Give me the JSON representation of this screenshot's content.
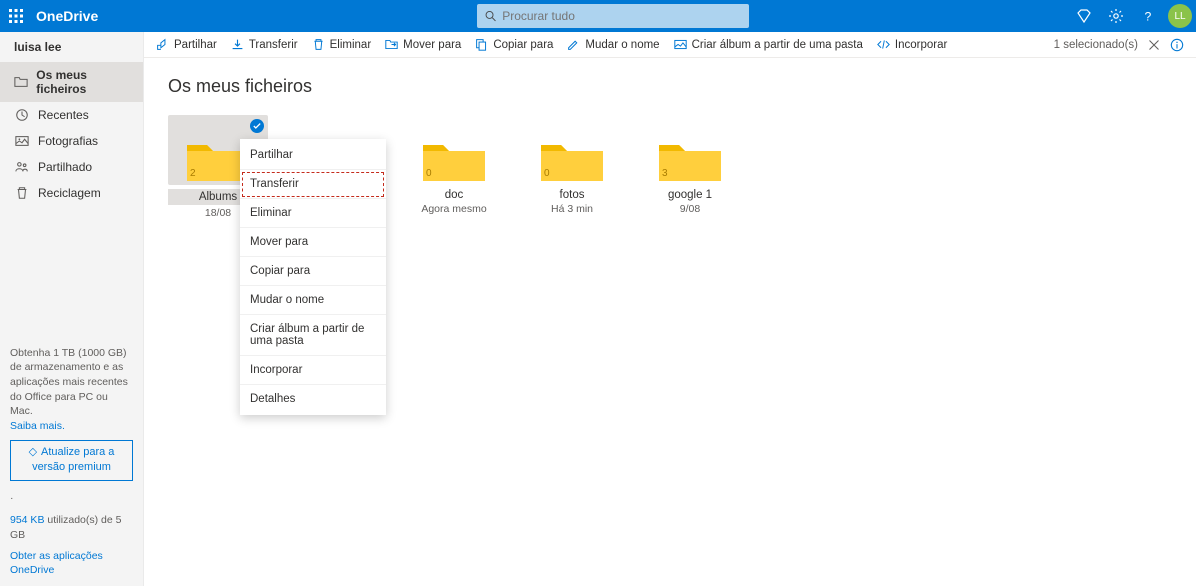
{
  "header": {
    "app_name": "OneDrive",
    "search_placeholder": "Procurar tudo",
    "avatar_initials": "LL"
  },
  "sidebar": {
    "user": "luisa lee",
    "items": [
      {
        "label": "Os meus ficheiros",
        "active": true
      },
      {
        "label": "Recentes"
      },
      {
        "label": "Fotografias"
      },
      {
        "label": "Partilhado"
      },
      {
        "label": "Reciclagem"
      }
    ],
    "promo": "Obtenha 1 TB (1000 GB) de armazenamento e as aplicações mais recentes do Office para PC ou Mac.",
    "learn_more": "Saiba mais.",
    "premium_btn": "Atualize para a versão premium",
    "storage_used": "954 KB",
    "storage_text": " utilizado(s) de 5 GB",
    "get_apps": "Obter as aplicações OneDrive"
  },
  "cmdbar": {
    "items": [
      "Partilhar",
      "Transferir",
      "Eliminar",
      "Mover para",
      "Copiar para",
      "Mudar o nome",
      "Criar álbum a partir de uma pasta",
      "Incorporar"
    ],
    "selection": "1 selecionado(s)"
  },
  "content": {
    "title": "Os meus ficheiros",
    "folders": [
      {
        "name": "Albums",
        "meta": "18/08",
        "count": "2",
        "selected": true
      },
      {
        "name": "",
        "meta": "",
        "count": ""
      },
      {
        "name": "doc",
        "meta": "Agora mesmo",
        "count": "0"
      },
      {
        "name": "fotos",
        "meta": "Há 3 min",
        "count": "0"
      },
      {
        "name": "google 1",
        "meta": "9/08",
        "count": "3"
      }
    ]
  },
  "context_menu": {
    "items": [
      "Partilhar",
      "Transferir",
      "Eliminar",
      "Mover para",
      "Copiar para",
      "Mudar o nome",
      "Criar álbum a partir de uma pasta",
      "Incorporar",
      "Detalhes"
    ],
    "highlighted": "Transferir"
  }
}
